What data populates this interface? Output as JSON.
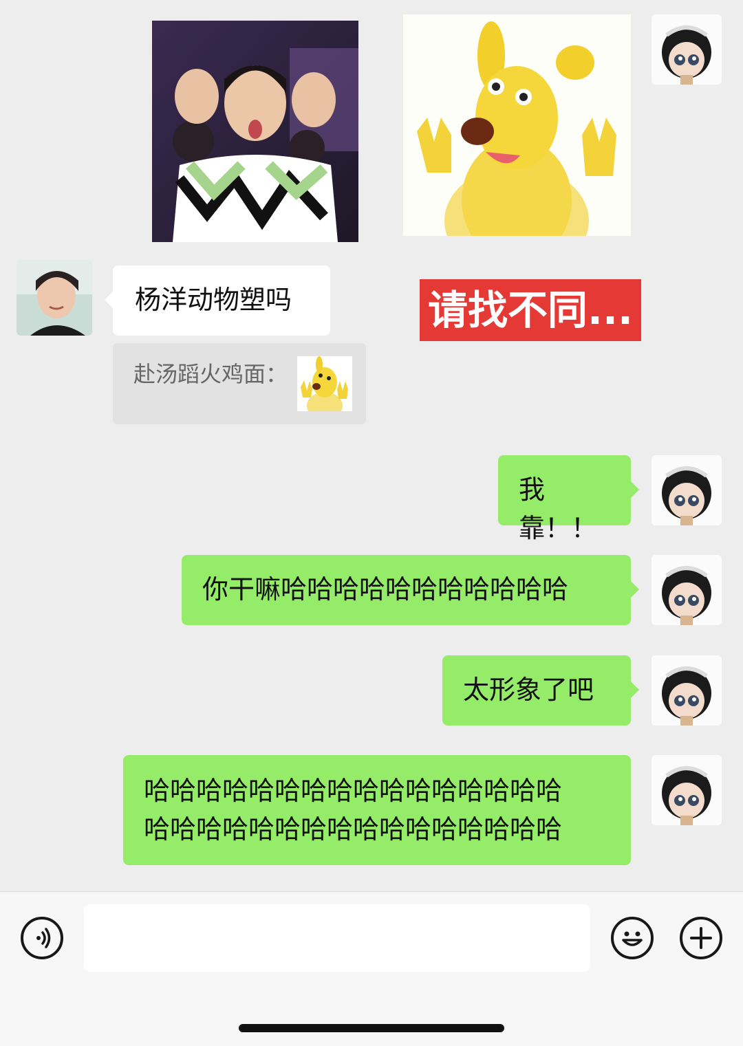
{
  "messages": {
    "sender_text": "杨洋动物塑吗",
    "quote_text": "赴汤蹈火鸡面：",
    "banner_text": "请找不同...",
    "my_msg_1": "我靠！！",
    "my_msg_2": "你干嘛哈哈哈哈哈哈哈哈哈哈哈",
    "my_msg_3": "太形象了吧",
    "my_msg_4_line1": "哈哈哈哈哈哈哈哈哈哈哈哈哈哈哈哈",
    "my_msg_4_line2": "哈哈哈哈哈哈哈哈哈哈哈哈哈哈哈哈"
  },
  "input": {
    "placeholder": ""
  },
  "icons": {
    "voice": "voice-icon",
    "emoji": "emoji-icon",
    "plus": "plus-icon"
  },
  "colors": {
    "my_bubble": "#95ec69",
    "their_bubble": "#ffffff",
    "chat_background": "#ededed",
    "banner": "#e53935"
  }
}
